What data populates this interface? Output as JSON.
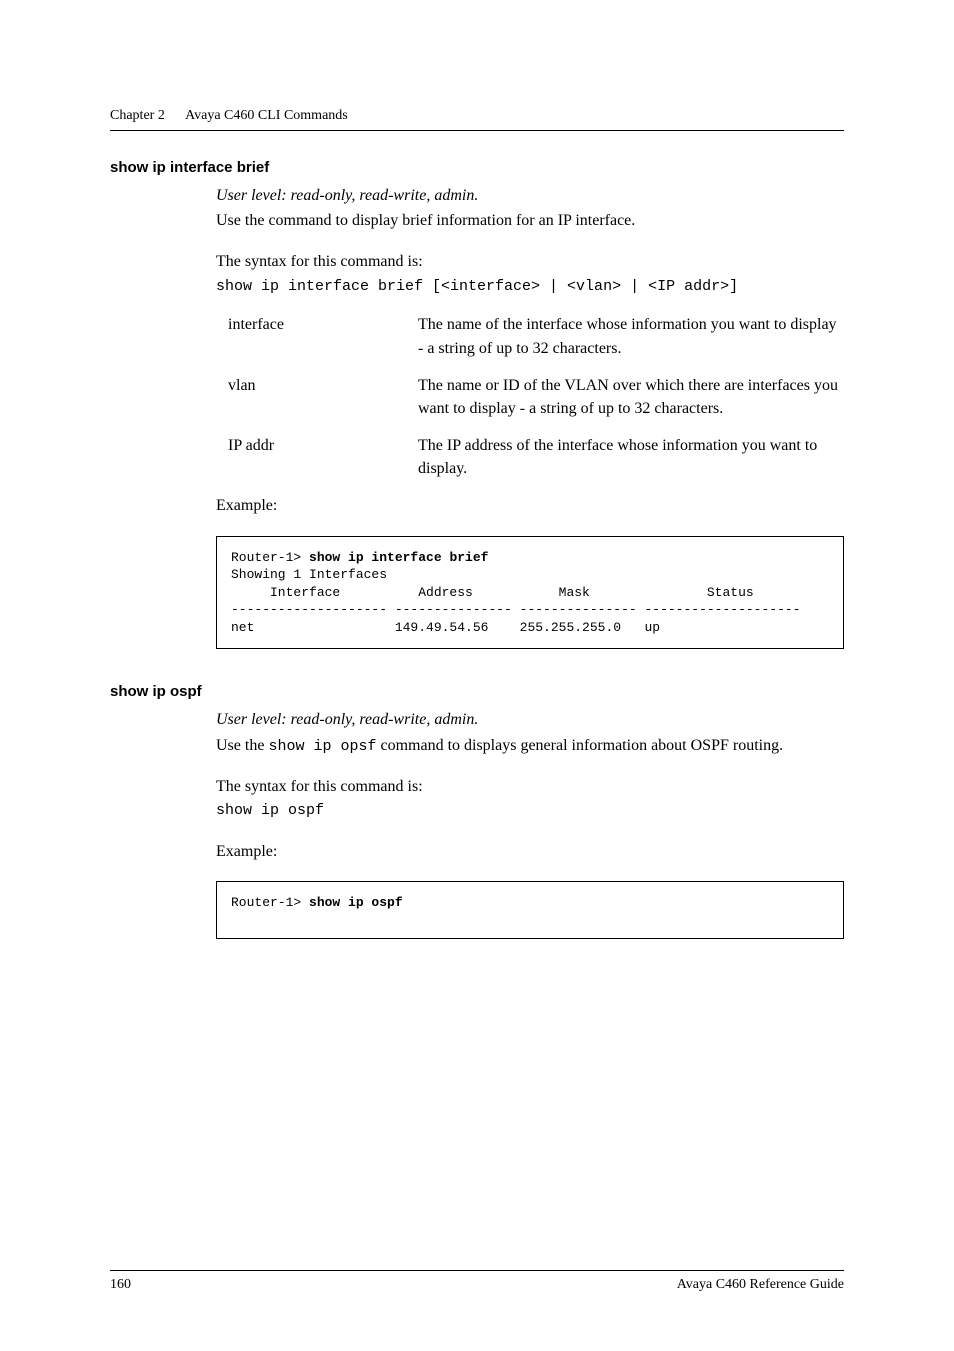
{
  "header": {
    "chapter": "Chapter 2",
    "title": "Avaya C460 CLI Commands"
  },
  "section1": {
    "title": "show ip interface brief",
    "user_level": "User level: read-only, read-write, admin.",
    "use_line_pre": "Use the ",
    "use_line_post": " command to display brief information for an IP interface.",
    "syntax_label": "The syntax for this command is:",
    "syntax_cmd": "show ip interface brief [<interface> | <vlan> | <IP addr>]",
    "defs": [
      {
        "term": "interface",
        "desc": "The name of the interface whose information you want to display - a string of up to 32 characters."
      },
      {
        "term": "vlan",
        "desc": "The name or ID of the VLAN over which there are interfaces you want to display - a string of up to 32 characters."
      },
      {
        "term": "IP addr",
        "desc": "The IP address of the interface whose information you want to display."
      }
    ],
    "example_label": "Example:",
    "example": {
      "prompt": "Router-1> ",
      "cmd": "show ip interface brief",
      "line1": "Showing 1 Interfaces",
      "line2": "     Interface          Address           Mask               Status",
      "line3": "-------------------- --------------- --------------- --------------------",
      "line4": "net                  149.49.54.56    255.255.255.0   up"
    }
  },
  "section2": {
    "title": "show ip ospf",
    "user_level": "User level: read-only, read-write, admin.",
    "use_pre": "Use the ",
    "use_mono": "show ip opsf",
    "use_post": " command to displays general information about OSPF routing.",
    "syntax_label": "The syntax for this command is:",
    "syntax_cmd": "show ip ospf",
    "example_label": "Example:",
    "example": {
      "prompt": "Router-1> ",
      "cmd": "show ip ospf"
    }
  },
  "footer": {
    "page": "160",
    "doc": "Avaya C460 Reference Guide"
  }
}
